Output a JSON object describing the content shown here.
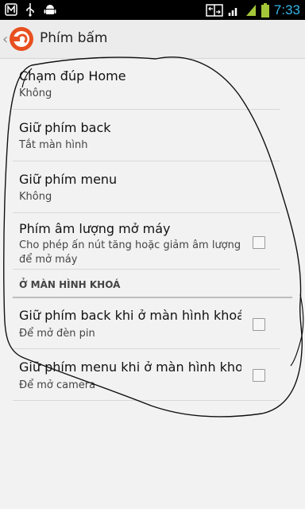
{
  "status_bar": {
    "time": "7:33",
    "left_icons": [
      "m-icon",
      "usb-icon",
      "android-icon"
    ],
    "right_icons": [
      "network-swap-icon",
      "wifi-icon",
      "signal-icon",
      "battery-icon"
    ]
  },
  "action_bar": {
    "title": "Phím bấm",
    "accent_color": "#e8501f"
  },
  "settings": [
    {
      "title": "Chạm đúp Home",
      "summary": "Không",
      "checkbox": false
    },
    {
      "title": "Giữ phím back",
      "summary": "Tắt màn hình",
      "checkbox": false
    },
    {
      "title": "Giữ phím menu",
      "summary": "Không",
      "checkbox": false
    },
    {
      "title": "Phím âm lượng mở máy",
      "summary": "Cho phép ấn nút tăng hoặc giảm âm lượng để mở máy",
      "checkbox": true,
      "checked": false
    }
  ],
  "lockscreen_category": {
    "header": "Ở MÀN HÌNH KHOÁ",
    "items": [
      {
        "title": "Giữ phím back khi ở màn hình khoá",
        "summary": "Để mở đèn pin",
        "checkbox": true,
        "checked": false
      },
      {
        "title": "Giữ phím menu khi ở màn hình khoá",
        "summary": "Để mở camera",
        "checkbox": true,
        "checked": false
      }
    ]
  }
}
